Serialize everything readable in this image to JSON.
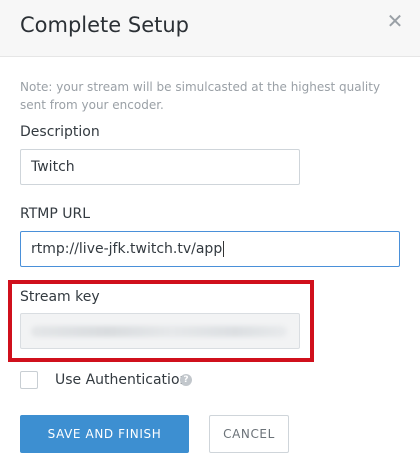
{
  "modal": {
    "title": "Complete Setup",
    "close_glyph": "✕",
    "note": "Note: your stream will be simulcasted at the highest quality sent from your encoder."
  },
  "form": {
    "description": {
      "label": "Description",
      "value": "Twitch"
    },
    "rtmp_url": {
      "label": "RTMP URL",
      "value": "rtmp://live-jfk.twitch.tv/app"
    },
    "stream_key": {
      "label": "Stream key"
    },
    "authentication": {
      "label": "Use Authentication",
      "checked": false,
      "help_glyph": "?"
    }
  },
  "buttons": {
    "save": "SAVE AND FINISH",
    "cancel": "CANCEL"
  },
  "colors": {
    "primary": "#3d8fd1",
    "highlight_border": "#d0101c",
    "focus_border": "#4a90d9"
  }
}
